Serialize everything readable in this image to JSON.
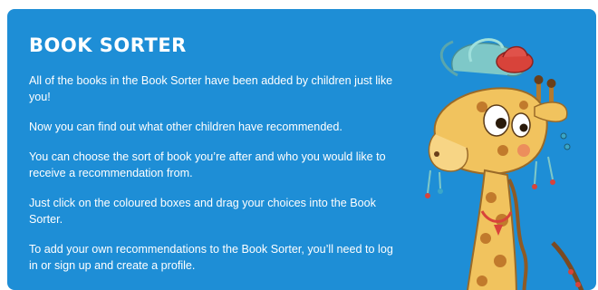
{
  "panel": {
    "title": "BOOK SORTER",
    "paragraphs": [
      "All of the books in the Book Sorter have been added by children just like you!",
      "Now you can find out what other children have recommended.",
      "You can choose the sort of book you’re after and who you would like to receive a recommendation from.",
      "Just click on the coloured boxes and drag your choices into the Book Sorter.",
      "To add your own recommendations to the Book Sorter, you’ll need to log in or sign up and create a profile."
    ]
  },
  "illustration": {
    "icon": "giraffe-illustration"
  },
  "colors": {
    "panel_background": "#1e8ed6",
    "text": "#ffffff"
  }
}
